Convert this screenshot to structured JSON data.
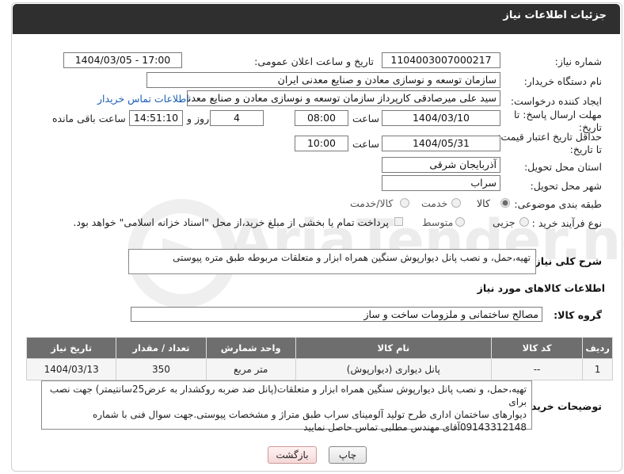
{
  "header": {
    "title": "جزئیات اطلاعات نیاز"
  },
  "watermark": {
    "text": "AriaTender.neT"
  },
  "fields": {
    "need_number": {
      "label": "شماره نیاز:",
      "value": "1104003007000217"
    },
    "announce_datetime": {
      "label": "تاریخ و ساعت اعلان عمومی:",
      "value": "1404/03/05 - 17:00"
    },
    "buyer_org": {
      "label": "نام دستگاه خریدار:",
      "value": "سازمان توسعه و نوسازی معادن و صنایع معدنی ایران"
    },
    "requester": {
      "label": "ایجاد کننده درخواست:",
      "value": "سید علی میرصادقی کارپرداز سازمان توسعه و نوسازی معادن و صنایع معدنی ای",
      "contact_link": "اطلاعات تماس خریدار"
    },
    "reply_deadline": {
      "label": "مهلت ارسال پاسخ: تا تاریخ:",
      "date": "1404/03/10",
      "time_label": "ساعت",
      "time": "08:00",
      "days": "4",
      "days_label": "روز و",
      "remaining": "14:51:10",
      "remaining_label": "ساعت باقی مانده"
    },
    "price_validity": {
      "label": "حداقل تاریخ اعتبار قیمت: تا تاریخ:",
      "date": "1404/05/31",
      "time_label": "ساعت",
      "time": "10:00"
    },
    "delivery_province": {
      "label": "استان محل تحویل:",
      "value": "آذربایجان شرقی"
    },
    "delivery_city": {
      "label": "شهر محل تحویل:",
      "value": "سراب"
    },
    "category": {
      "label": "طبقه بندی موضوعی:",
      "options": [
        "کالا",
        "خدمت",
        "کالا/خدمت"
      ],
      "selected": "کالا"
    },
    "purchase_type": {
      "label": "نوع فرآیند خرید :",
      "options": [
        "جزیی",
        "متوسط"
      ],
      "note": "پرداخت تمام یا بخشی از مبلغ خرید،از محل \"اسناد خزانه اسلامی\" خواهد بود."
    }
  },
  "description": {
    "label": "شرح کلی نیاز:",
    "value": "تهیه،حمل، و نصب پانل دیوارپوش سنگین همراه ابزار و متعلقات مربوطه طبق متره پیوستی"
  },
  "goods_section": {
    "title": "اطلاعات کالاهای مورد نیاز",
    "group_label": "گروه کالا:",
    "group_value": "مصالح ساختمانی و ملزومات ساخت و ساز"
  },
  "table": {
    "headers": [
      "ردیف",
      "کد کالا",
      "نام کالا",
      "واحد شمارش",
      "تعداد / مقدار",
      "تاریخ نیاز"
    ],
    "rows": [
      [
        "1",
        "--",
        "پانل دیواری (دیوارپوش)",
        "متر مربع",
        "350",
        "1404/03/13"
      ]
    ]
  },
  "buyer_notes": {
    "label": "توضیحات خریدار:",
    "lines": [
      "تهیه،حمل، و نصب پانل دیوارپوش سنگین همراه ابزار و متعلقات(پانل ضد ضربه روکشدار به عرض25سانتیمتر) جهت نصب برای",
      "دیوارهای ساختمان اداری طرح تولید آلومینای سراب طبق متراژ و مشخصات پیوستی.جهت سوال فنی با شماره",
      "09143312148آقای مهندس مطلبی تماس حاصل نمایید"
    ]
  },
  "buttons": {
    "print": "چاپ",
    "back": "بازگشت"
  }
}
